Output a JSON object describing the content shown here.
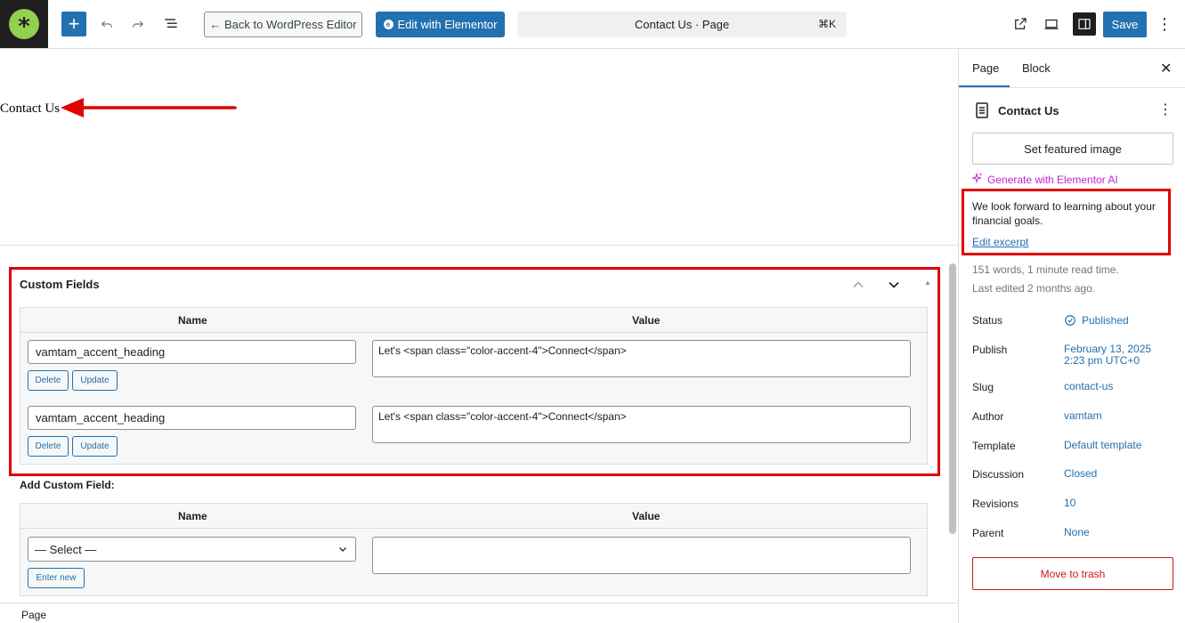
{
  "toolbar": {
    "back_label": "← Back to WordPress Editor",
    "elementor_label": "Edit with Elementor",
    "command_title": "Contact Us · Page",
    "command_shortcut": "⌘K",
    "save_label": "Save"
  },
  "canvas": {
    "page_title": "Contact Us"
  },
  "custom_fields": {
    "title": "Custom Fields",
    "col_name": "Name",
    "col_value": "Value",
    "rows": [
      {
        "name": "vamtam_accent_heading",
        "value": "Let's <span class=\"color-accent-4\">Connect</span>",
        "delete": "Delete",
        "update": "Update"
      },
      {
        "name": "vamtam_accent_heading",
        "value": "Let's <span class=\"color-accent-4\">Connect</span>",
        "delete": "Delete",
        "update": "Update"
      }
    ],
    "add_label": "Add Custom Field:",
    "add_col_name": "Name",
    "add_col_value": "Value",
    "select_value": "— Select —",
    "enter_new": "Enter new"
  },
  "footer": {
    "breadcrumb": "Page"
  },
  "sidebar": {
    "tabs": [
      {
        "label": "Page"
      },
      {
        "label": "Block"
      }
    ],
    "doc_title": "Contact Us",
    "featured_image": "Set featured image",
    "generate_ai": "Generate with Elementor AI",
    "excerpt": "We look forward to learning about your financial goals.",
    "edit_excerpt": "Edit excerpt",
    "word_count": "151 words, 1 minute read time.",
    "last_edited": "Last edited 2 months ago.",
    "meta": {
      "status_label": "Status",
      "status_value": "Published",
      "publish_label": "Publish",
      "publish_line1": "February 13, 2025",
      "publish_line2": "2:23 pm UTC+0",
      "slug_label": "Slug",
      "slug_value": "contact-us",
      "author_label": "Author",
      "author_value": "vamtam",
      "template_label": "Template",
      "template_value": "Default template",
      "discussion_label": "Discussion",
      "discussion_value": "Closed",
      "revisions_label": "Revisions",
      "revisions_value": "10",
      "parent_label": "Parent",
      "parent_value": "None"
    },
    "trash_label": "Move to trash"
  },
  "colors": {
    "accent": "#2271b1",
    "highlight_red": "#e00000",
    "ai_purple": "#c026d3",
    "danger": "#cc1818"
  }
}
